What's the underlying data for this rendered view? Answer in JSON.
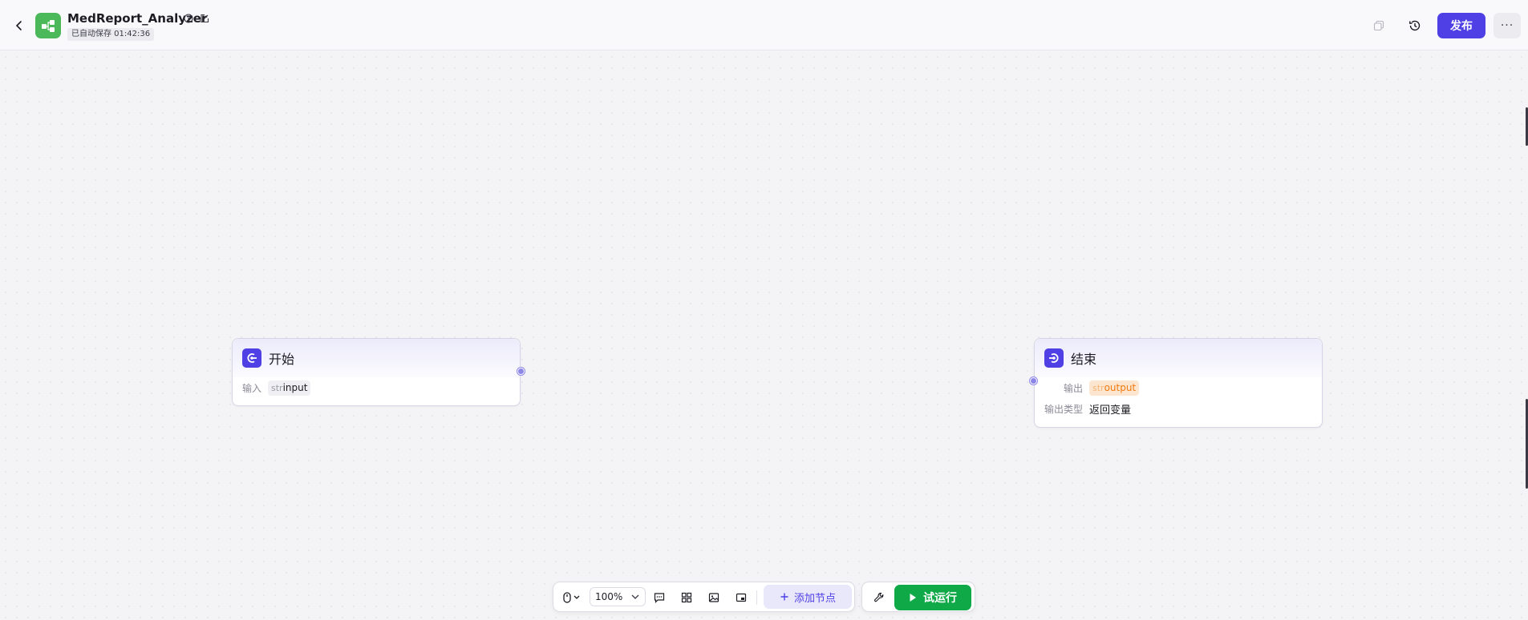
{
  "header": {
    "title": "MedReport_Analyzer",
    "autosave": "已自动保存 01:42:36",
    "publish_label": "发布",
    "more_label": "···"
  },
  "nodes": {
    "start": {
      "title": "开始",
      "input_label": "输入",
      "input_var": {
        "type": "str",
        "name": "input"
      }
    },
    "end": {
      "title": "结束",
      "output_label": "输出",
      "output_var": {
        "type": "str",
        "name": "output"
      },
      "output_type_label": "输出类型",
      "output_type_value": "返回变量"
    }
  },
  "toolbar": {
    "zoom": "100%",
    "add_node_label": "添加节点",
    "trial_run_label": "试运行"
  },
  "colors": {
    "accent": "#4e40e5",
    "run_green": "#0fa948",
    "logo_green": "#4bb85a",
    "output_tag": "#f07a0e"
  }
}
